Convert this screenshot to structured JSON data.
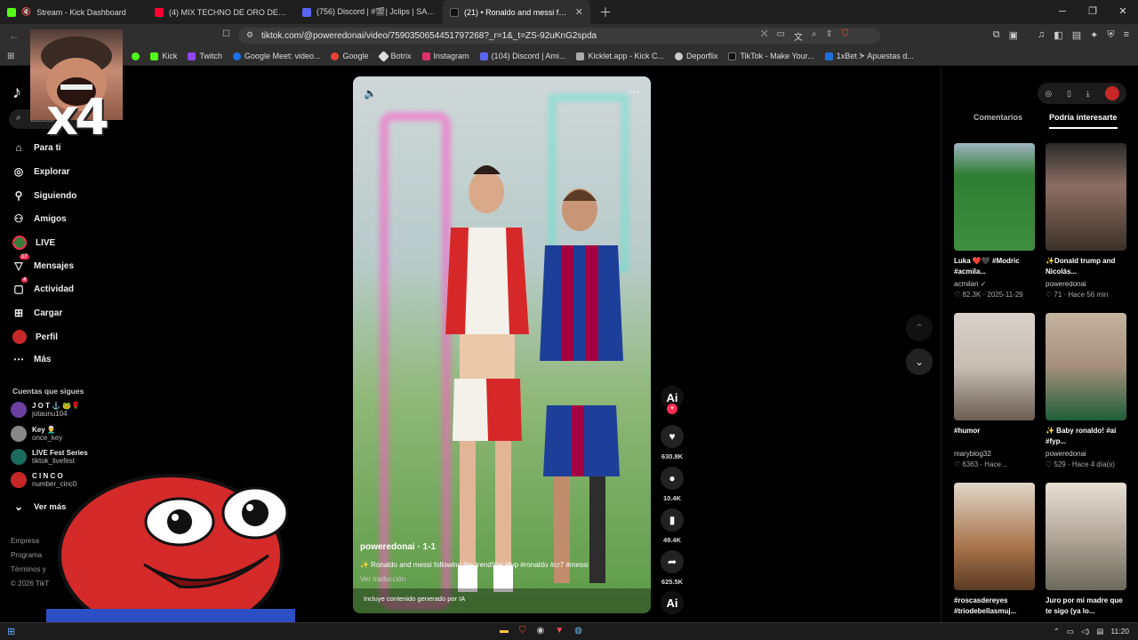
{
  "tabs": [
    {
      "title": "Stream - Kick Dashboard",
      "color": "#53fc18"
    },
    {
      "title": "(4) MIX TECHNO DE ORO DE 80's & '",
      "color": "#ff0033"
    },
    {
      "title": "(756) Discord | #🎬| Jclips | SAPOLIC",
      "color": "#5865f2"
    },
    {
      "title": "(21) • Ronaldo and messi follow",
      "color": "#111111"
    }
  ],
  "address": {
    "url": "tiktok.com/@poweredonai/video/7590350654451797268?_r=1&_t=ZS-92uKnG2spda"
  },
  "bookmarks": [
    {
      "label": "Kick",
      "color": "#53fc18"
    },
    {
      "label": "Twitch",
      "color": "#9146ff"
    },
    {
      "label": "Google Meet: video...",
      "color": "#1a73e8"
    },
    {
      "label": "Google",
      "color": "#ea4335"
    },
    {
      "label": "Botrix",
      "color": "#dddddd"
    },
    {
      "label": "Instagram",
      "color": "#e1306c"
    },
    {
      "label": "(104) Discord | Ami...",
      "color": "#5865f2"
    },
    {
      "label": "Kicklet.app - Kick C...",
      "color": "#aaaaaa"
    },
    {
      "label": "Deporflix",
      "color": "#cccccc"
    },
    {
      "label": "TikTok - Make Your...",
      "color": "#111111"
    },
    {
      "label": "1xBet ᗒ Apuestas d...",
      "color": "#1e6fd9"
    }
  ],
  "sidebar": {
    "search_placeholder": "Buscar",
    "items": [
      {
        "label": "Para ti",
        "icon": "home-icon"
      },
      {
        "label": "Explorar",
        "icon": "compass-icon"
      },
      {
        "label": "Siguiendo",
        "icon": "following-icon"
      },
      {
        "label": "Amigos",
        "icon": "friends-icon"
      },
      {
        "label": "LIVE",
        "icon": "live-icon"
      },
      {
        "label": "Mensajes",
        "icon": "messages-icon",
        "badge": "17"
      },
      {
        "label": "Actividad",
        "icon": "activity-icon",
        "badge": "4"
      },
      {
        "label": "Cargar",
        "icon": "upload-icon"
      },
      {
        "label": "Perfil",
        "icon": "profile-icon"
      },
      {
        "label": "Más",
        "icon": "more-icon"
      }
    ],
    "following_title": "Cuentas que sigues",
    "accounts": [
      {
        "name": "J O T ⚓ 🐸🌹",
        "handle": "jotaunu104",
        "color": "#6b3fa0"
      },
      {
        "name": "Key 👨‍🦳",
        "handle": "once_key",
        "color": "#888888"
      },
      {
        "name": "LIVE Fest Series",
        "handle": "tiktok_livefest",
        "color": "#1b6b5f"
      },
      {
        "name": "C I N C O",
        "handle": "number_cinc0",
        "color": "#c62828"
      }
    ],
    "see_more": "Ver más",
    "footer": [
      "Empresa",
      "Programa",
      "Términos y",
      "© 2026 TikT"
    ]
  },
  "overlay": {
    "text": "x4"
  },
  "video": {
    "author": "poweredonai · 1-1",
    "description": "✨ Ronaldo and messi following the trend!#ai #fyp #ronaldo #cr7 #messi",
    "translate": "Ver traducción",
    "ai_label": "Incluye contenido generado por IA"
  },
  "actions": [
    {
      "name": "like",
      "icon": "heart-icon",
      "count": "630.8K"
    },
    {
      "name": "comment",
      "icon": "comment-icon",
      "count": "10.4K"
    },
    {
      "name": "save",
      "icon": "bookmark-icon",
      "count": "49.4K"
    },
    {
      "name": "share",
      "icon": "share-icon",
      "count": "625.5K"
    }
  ],
  "right_panel": {
    "tabs": [
      "Comentarios",
      "Podría interesarte"
    ],
    "cards": [
      {
        "title": "Luka ❤️🖤 #Modric #acmila...",
        "user": "acmilan ✓",
        "meta": "♡ 82.3K · 2025-11-29",
        "color": "#2e7d32"
      },
      {
        "title": "✨Donald trump and Nicolás...",
        "user": "poweredonai",
        "meta": "♡ 71 · Hace 56 min",
        "color": "#8d6e63"
      },
      {
        "title": "#humor",
        "user": "maryblog32",
        "meta": "♡ 6363 · Hace...",
        "color": "#c7beb3"
      },
      {
        "title": "✨ Baby ronaldo! #ai #fyp...",
        "user": "poweredonai",
        "meta": "♡ 529 · Hace 4 día(s)",
        "color": "#a58f7a"
      },
      {
        "title": "#roscasdereyes #triodebellasmuj...",
        "user": "",
        "meta": "",
        "color": "#a8744a"
      },
      {
        "title": "Juro por mi madre que te sigo (ya lo...",
        "user": "",
        "meta": "",
        "color": "#b3a79a"
      }
    ]
  },
  "taskbar": {
    "clock": "11:20"
  }
}
